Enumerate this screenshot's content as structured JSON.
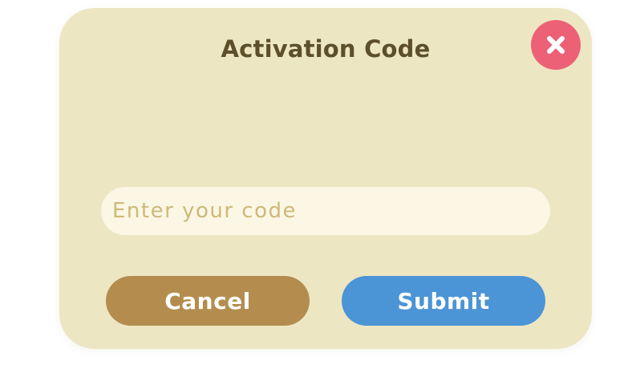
{
  "dialog": {
    "title": "Activation Code",
    "close_icon": "close-icon",
    "input": {
      "value": "",
      "placeholder": "Enter your code"
    },
    "cancel_label": "Cancel",
    "submit_label": "Submit"
  },
  "colors": {
    "panel": "#ede6c3",
    "title": "#5c4f2a",
    "close_button": "#ec6176",
    "input_bg": "#fbf7e4",
    "placeholder": "#cdb97a",
    "cancel_button": "#b48d4e",
    "submit_button": "#4b94d6"
  }
}
